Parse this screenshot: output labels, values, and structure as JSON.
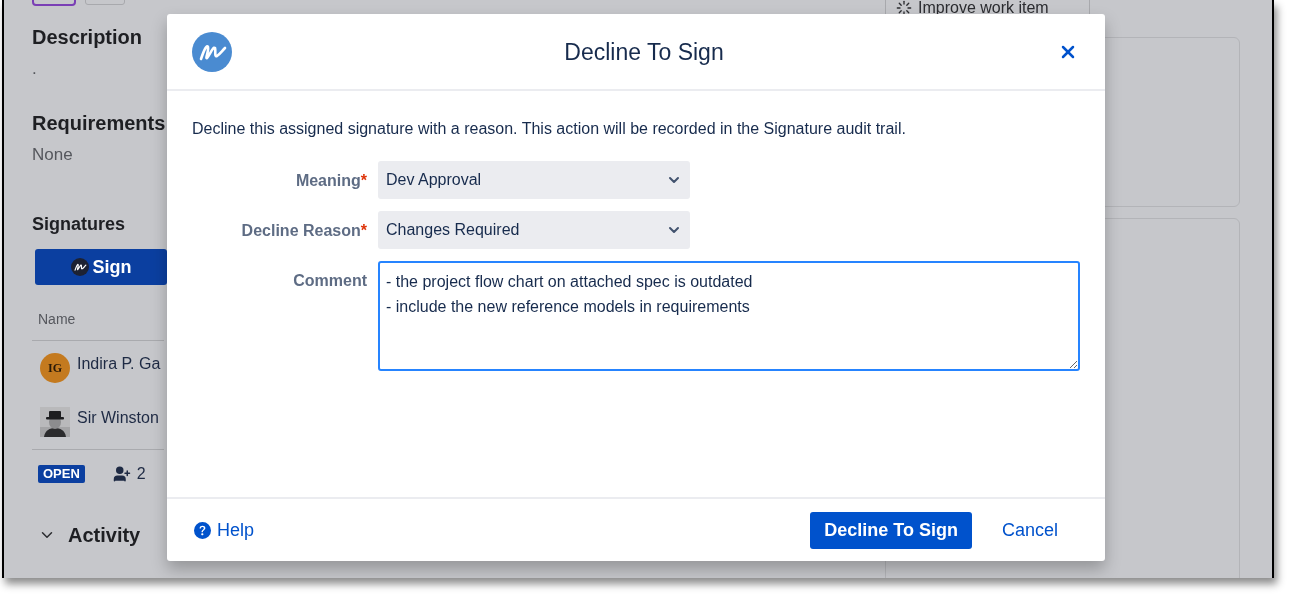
{
  "background": {
    "top_button": "Improve work item",
    "sections": [
      {
        "heading": "Description",
        "text": "."
      },
      {
        "heading": "Requirements",
        "text": "None"
      }
    ],
    "signatures": {
      "heading": "Signatures",
      "sign_button": "Sign",
      "column": "Name",
      "signers": [
        {
          "kind": "initials",
          "initials": "IG",
          "name": "Indira P. Ga"
        },
        {
          "kind": "picture",
          "name": "Sir Winston"
        }
      ],
      "status": "OPEN",
      "signer_count": "2"
    },
    "activity": {
      "heading": "Activity",
      "expanded": true
    }
  },
  "dialog": {
    "title": "Decline To Sign",
    "description": "Decline this assigned signature with a reason. This action will be recorded in the Signature audit trail.",
    "fields": [
      {
        "kind": "select",
        "label": "Meaning",
        "required_mark": "*",
        "value": "Dev Approval"
      },
      {
        "kind": "select",
        "label": "Decline Reason",
        "required_mark": "*",
        "value": "Changes Required"
      },
      {
        "kind": "textarea",
        "label": "Comment",
        "focused": true,
        "value": "- the project flow chart on attached spec is outdated\n- include the new reference models in requirements"
      }
    ],
    "help": "Help",
    "primary_button": "Decline To Sign",
    "cancel": "Cancel"
  }
}
